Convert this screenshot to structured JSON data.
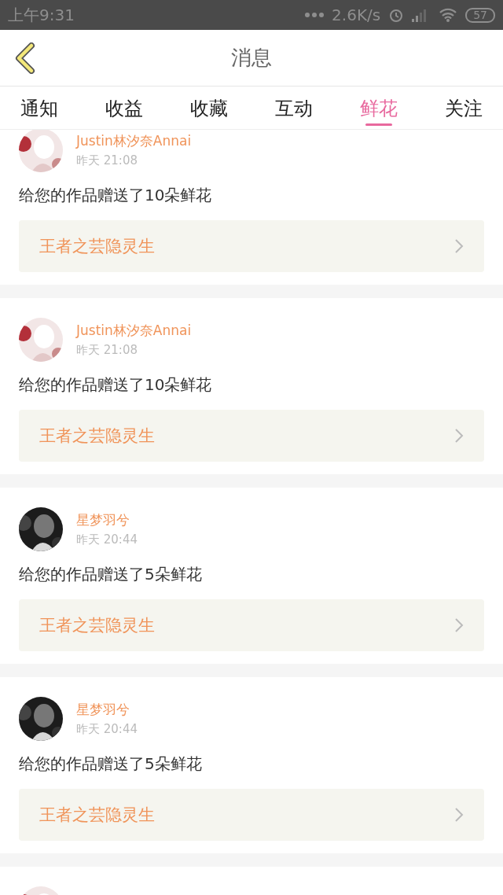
{
  "status_bar": {
    "time": "上午9:31",
    "speed": "2.6K/s",
    "battery": "57"
  },
  "header": {
    "title": "消息"
  },
  "tabs": [
    {
      "label": "通知",
      "selected": false
    },
    {
      "label": "收益",
      "selected": false
    },
    {
      "label": "收藏",
      "selected": false
    },
    {
      "label": "互动",
      "selected": false
    },
    {
      "label": "鲜花",
      "selected": true
    },
    {
      "label": "关注",
      "selected": false
    }
  ],
  "messages": [
    {
      "name": "Justin林汐奈Annai",
      "time": "昨天 21:08",
      "text": "给您的作品赠送了10朵鲜花",
      "work": "王者之芸隐灵生"
    },
    {
      "name": "Justin林汐奈Annai",
      "time": "昨天 21:08",
      "text": "给您的作品赠送了10朵鲜花",
      "work": "王者之芸隐灵生"
    },
    {
      "name": "星梦羽兮",
      "time": "昨天 20:44",
      "text": "给您的作品赠送了5朵鲜花",
      "work": "王者之芸隐灵生"
    },
    {
      "name": "星梦羽兮",
      "time": "昨天 20:44",
      "text": "给您的作品赠送了5朵鲜花",
      "work": "王者之芸隐灵生"
    }
  ]
}
